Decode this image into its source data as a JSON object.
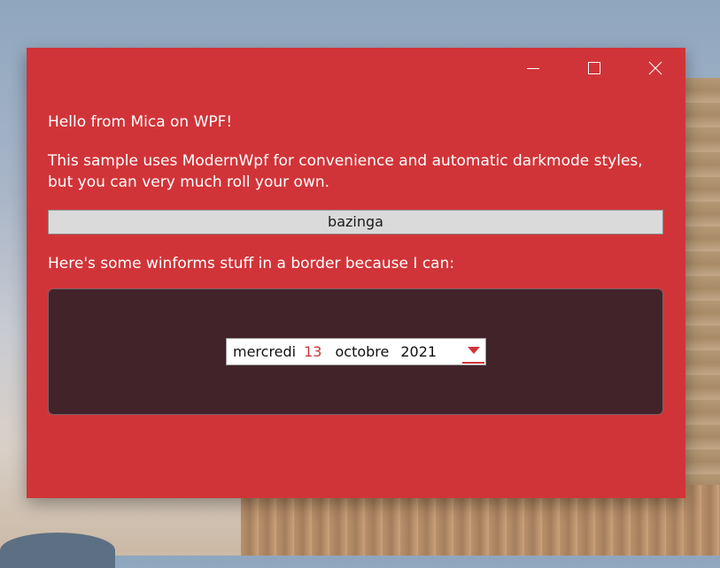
{
  "window": {
    "background": "#d13438",
    "caption": {
      "minimize_icon": "minimize-icon",
      "maximize_icon": "maximize-icon",
      "close_icon": "close-icon"
    }
  },
  "content": {
    "hello": "Hello from Mica on WPF!",
    "description": "This sample uses ModernWpf for convenience and automatic darkmode styles, but you can very much roll your own.",
    "button_label": "bazinga",
    "winforms_label": "Here's some winforms stuff in a border because I can:"
  },
  "date_picker": {
    "weekday": "mercredi",
    "day": "13",
    "month": "octobre",
    "year": "2021",
    "dropdown_icon": "dropdown-arrow-icon",
    "accent_color": "#c8363b"
  },
  "panel": {
    "background": "#42232a"
  }
}
